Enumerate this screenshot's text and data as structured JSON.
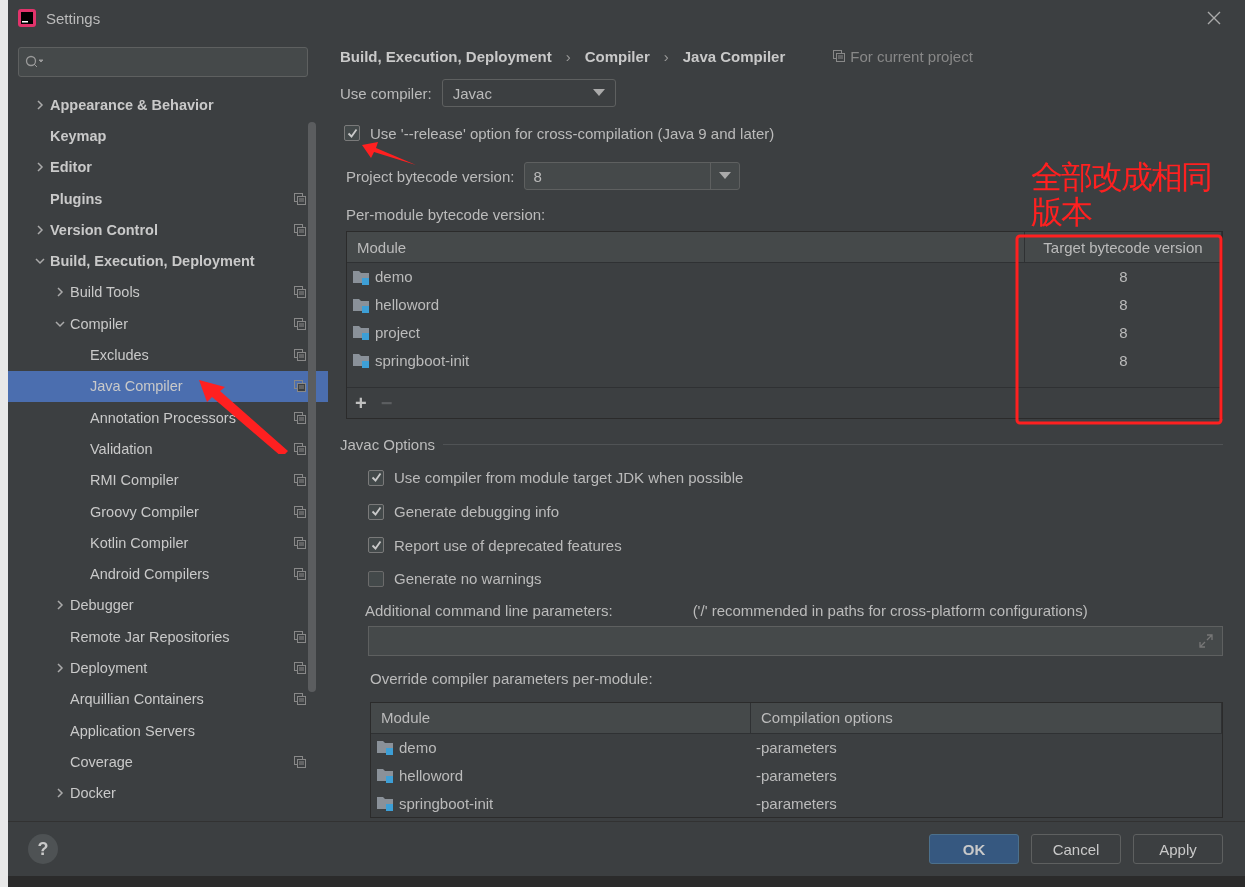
{
  "window": {
    "title": "Settings"
  },
  "sidebar": {
    "items": [
      {
        "label": "Appearance & Behavior",
        "expanded": false,
        "project_scope": false,
        "selected": false
      },
      {
        "label": "Keymap",
        "project_scope": false,
        "selected": false
      },
      {
        "label": "Editor",
        "expanded": false,
        "project_scope": false,
        "selected": false
      },
      {
        "label": "Plugins",
        "project_scope": true,
        "selected": false
      },
      {
        "label": "Version Control",
        "expanded": false,
        "project_scope": true,
        "selected": false
      },
      {
        "label": "Build, Execution, Deployment",
        "expanded": true,
        "project_scope": false,
        "selected": false,
        "children": [
          {
            "label": "Build Tools",
            "expanded": false,
            "project_scope": true,
            "selected": false
          },
          {
            "label": "Compiler",
            "expanded": true,
            "project_scope": true,
            "selected": false,
            "children": [
              {
                "label": "Excludes",
                "project_scope": true,
                "selected": false
              },
              {
                "label": "Java Compiler",
                "project_scope": true,
                "selected": true
              },
              {
                "label": "Annotation Processors",
                "project_scope": true,
                "selected": false
              },
              {
                "label": "Validation",
                "project_scope": true,
                "selected": false
              },
              {
                "label": "RMI Compiler",
                "project_scope": true,
                "selected": false
              },
              {
                "label": "Groovy Compiler",
                "project_scope": true,
                "selected": false
              },
              {
                "label": "Kotlin Compiler",
                "project_scope": true,
                "selected": false
              },
              {
                "label": "Android Compilers",
                "project_scope": true,
                "selected": false
              }
            ]
          },
          {
            "label": "Debugger",
            "expanded": false,
            "project_scope": false,
            "selected": false
          },
          {
            "label": "Remote Jar Repositories",
            "project_scope": true,
            "selected": false
          },
          {
            "label": "Deployment",
            "expanded": false,
            "project_scope": true,
            "selected": false
          },
          {
            "label": "Arquillian Containers",
            "project_scope": true,
            "selected": false
          },
          {
            "label": "Application Servers",
            "project_scope": false,
            "selected": false
          },
          {
            "label": "Coverage",
            "project_scope": true,
            "selected": false
          },
          {
            "label": "Docker",
            "expanded": false,
            "project_scope": false,
            "selected": false
          }
        ]
      }
    ]
  },
  "breadcrumb": {
    "items": [
      "Build, Execution, Deployment",
      "Compiler",
      "Java Compiler"
    ],
    "separator": "›"
  },
  "scope_note": "For current project",
  "use_compiler": {
    "label": "Use compiler:",
    "value": "Javac"
  },
  "release_option": {
    "label": "Use '--release' option for cross-compilation (Java 9 and later)",
    "checked": true
  },
  "project_bytecode": {
    "label": "Project bytecode version:",
    "value": "8"
  },
  "per_module": {
    "label": "Per-module bytecode version:",
    "columns": [
      "Module",
      "Target bytecode version"
    ],
    "rows": [
      {
        "module": "demo",
        "version": "8"
      },
      {
        "module": "helloword",
        "version": "8"
      },
      {
        "module": "project",
        "version": "8"
      },
      {
        "module": "springboot-init",
        "version": "8"
      }
    ],
    "toolbar": [
      "+",
      "−"
    ]
  },
  "javac": {
    "title": "Javac Options",
    "options": [
      {
        "label": "Use compiler from module target JDK when possible",
        "checked": true
      },
      {
        "label": "Generate debugging info",
        "checked": true
      },
      {
        "label": "Report use of deprecated features",
        "checked": true
      },
      {
        "label": "Generate no warnings",
        "checked": false
      }
    ],
    "params_label": "Additional command line parameters:",
    "params_hint": "('/' recommended in paths for cross-platform configurations)",
    "override_label": "Override compiler parameters per-module:",
    "override_columns": [
      "Module",
      "Compilation options"
    ],
    "override_rows": [
      {
        "module": "demo",
        "options": "-parameters"
      },
      {
        "module": "helloword",
        "options": "-parameters"
      },
      {
        "module": "springboot-init",
        "options": "-parameters"
      }
    ]
  },
  "buttons": [
    {
      "label": "OK",
      "default": true
    },
    {
      "label": "Cancel",
      "default": false
    },
    {
      "label": "Apply",
      "default": false
    }
  ],
  "help": "?",
  "annotation": {
    "note": "全部改成相同版本"
  }
}
